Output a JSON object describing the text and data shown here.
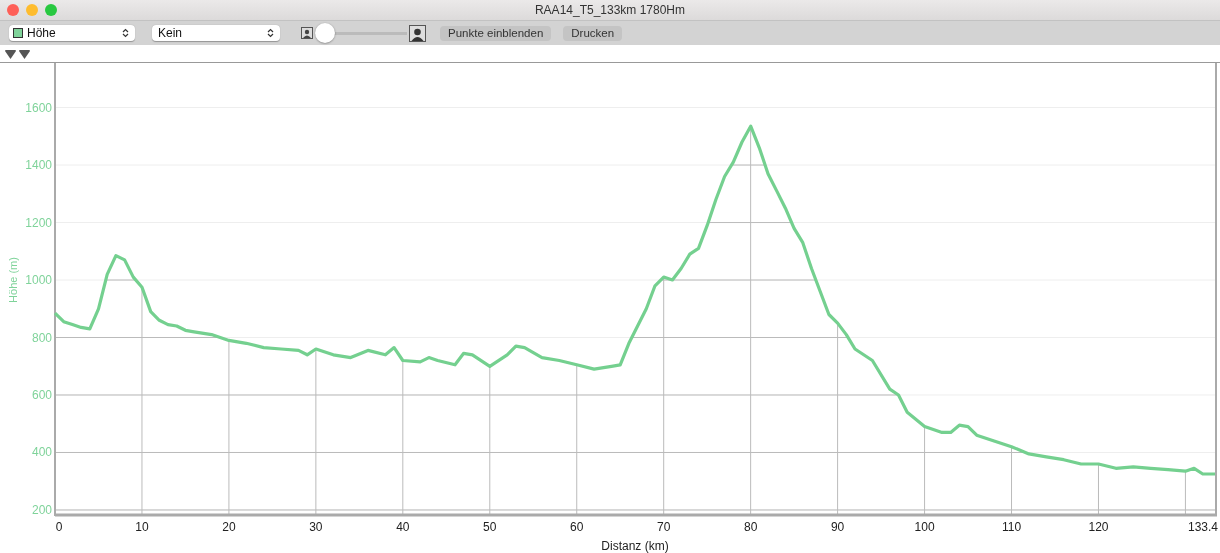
{
  "window": {
    "title": "RAA14_T5_133km 1780Hm"
  },
  "toolbar": {
    "data_select": {
      "value": "Höhe",
      "color": "#7fd39a"
    },
    "second_select": {
      "value": "Kein"
    },
    "zoom_slider": {
      "level": 0
    },
    "buttons": [
      "Punkte einblenden",
      "Drucken"
    ]
  },
  "chart": {
    "chart_data": {
      "type": "line",
      "xlabel": "Distanz (km)",
      "ylabel": "Höhe (m)",
      "x": [
        0,
        1,
        2,
        3,
        4,
        5,
        6,
        7,
        8,
        9,
        10,
        11,
        12,
        13,
        14,
        15,
        16,
        18,
        20,
        22,
        24,
        26,
        28,
        29,
        30,
        32,
        34,
        36,
        38,
        39,
        40,
        42,
        43,
        44,
        46,
        47,
        48,
        50,
        52,
        53,
        54,
        56,
        58,
        60,
        62,
        64,
        65,
        66,
        68,
        69,
        70,
        71,
        72,
        73,
        74,
        75,
        76,
        77,
        78,
        79,
        80,
        81,
        82,
        83,
        84,
        85,
        86,
        87,
        88,
        89,
        90,
        91,
        92,
        94,
        96,
        97,
        98,
        100,
        102,
        103,
        104,
        105,
        106,
        108,
        110,
        112,
        114,
        116,
        118,
        120,
        122,
        124,
        126,
        128,
        130,
        131,
        132,
        133.4
      ],
      "series": [
        {
          "color": "#74d08f",
          "values": [
            885,
            855,
            845,
            835,
            830,
            900,
            1020,
            1085,
            1070,
            1010,
            975,
            890,
            860,
            845,
            840,
            825,
            820,
            810,
            790,
            780,
            765,
            760,
            755,
            740,
            760,
            740,
            730,
            755,
            740,
            765,
            720,
            715,
            730,
            720,
            705,
            745,
            740,
            700,
            740,
            770,
            765,
            730,
            720,
            705,
            690,
            700,
            705,
            780,
            900,
            980,
            1010,
            1000,
            1040,
            1090,
            1110,
            1190,
            1280,
            1360,
            1410,
            1480,
            1535,
            1460,
            1370,
            1310,
            1250,
            1180,
            1130,
            1040,
            960,
            880,
            850,
            810,
            760,
            720,
            620,
            600,
            540,
            490,
            470,
            470,
            495,
            490,
            460,
            440,
            420,
            395,
            385,
            375,
            360,
            360,
            345,
            350,
            345,
            340,
            335,
            345,
            325,
            325
          ]
        }
      ],
      "grid": true,
      "xlim": [
        0,
        133.4
      ],
      "ylim": [
        186,
        1755
      ],
      "xticks": [
        0,
        10,
        20,
        30,
        40,
        50,
        60,
        70,
        80,
        90,
        100,
        110,
        120,
        133.4
      ],
      "yticks": [
        200,
        400,
        600,
        800,
        1000,
        1200,
        1400,
        1600
      ]
    }
  }
}
